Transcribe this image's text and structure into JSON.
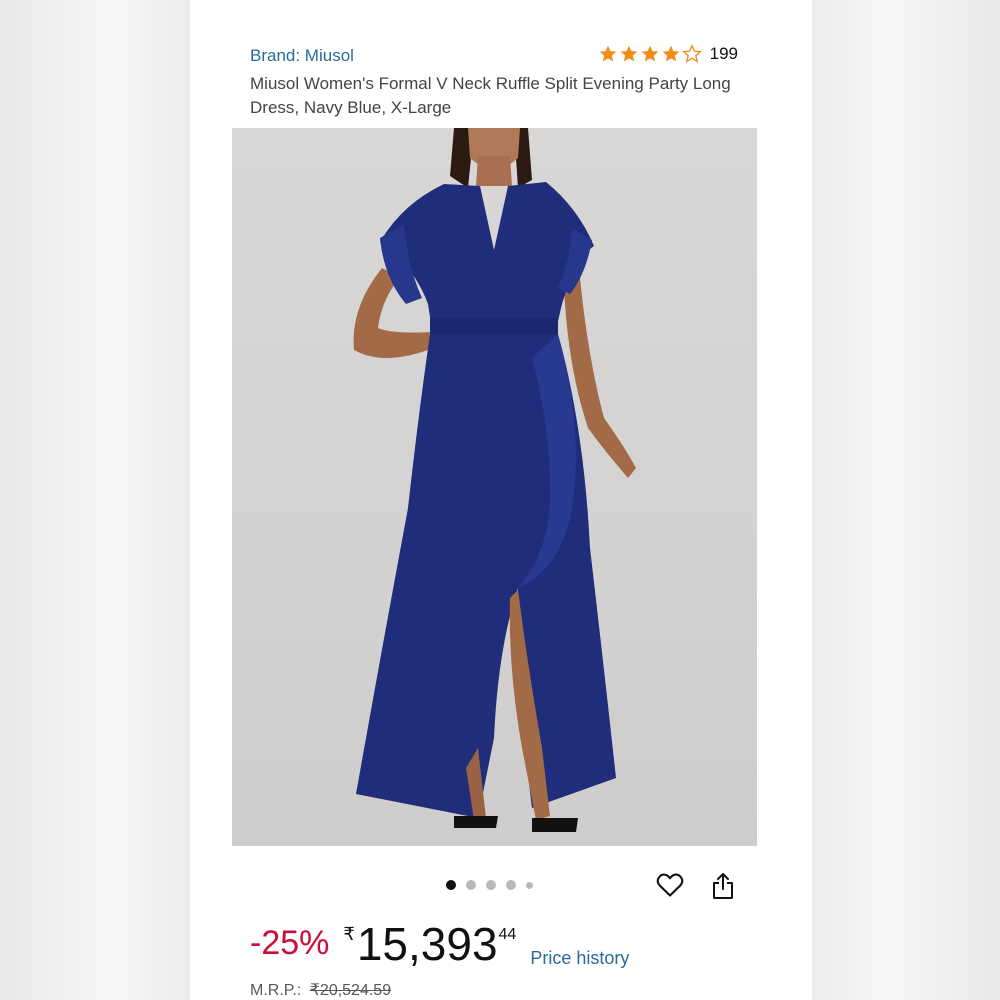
{
  "product": {
    "brand": "Brand: Miusol",
    "title": "Miusol Women's Formal V Neck Ruffle Split Evening Party Long Dress, Navy Blue, X-Large",
    "rating_value": 4.5,
    "rating_count": "199",
    "image_alt_icon": "product-photo",
    "carousel_pages": 5,
    "carousel_active": 1
  },
  "price": {
    "discount": "-25%",
    "currency": "₹",
    "whole": "15,393",
    "fraction": "44",
    "price_history_label": "Price history",
    "mrp_label": "M.R.P.:",
    "mrp_value": "₹20,524.59"
  },
  "icons": {
    "wishlist": "heart-icon",
    "share": "share-icon",
    "star": "star-icon"
  },
  "colors": {
    "link": "#2a6a9a",
    "discount": "#cc0c39",
    "star": "#f08c1a",
    "dress": "#1f2d7a"
  }
}
